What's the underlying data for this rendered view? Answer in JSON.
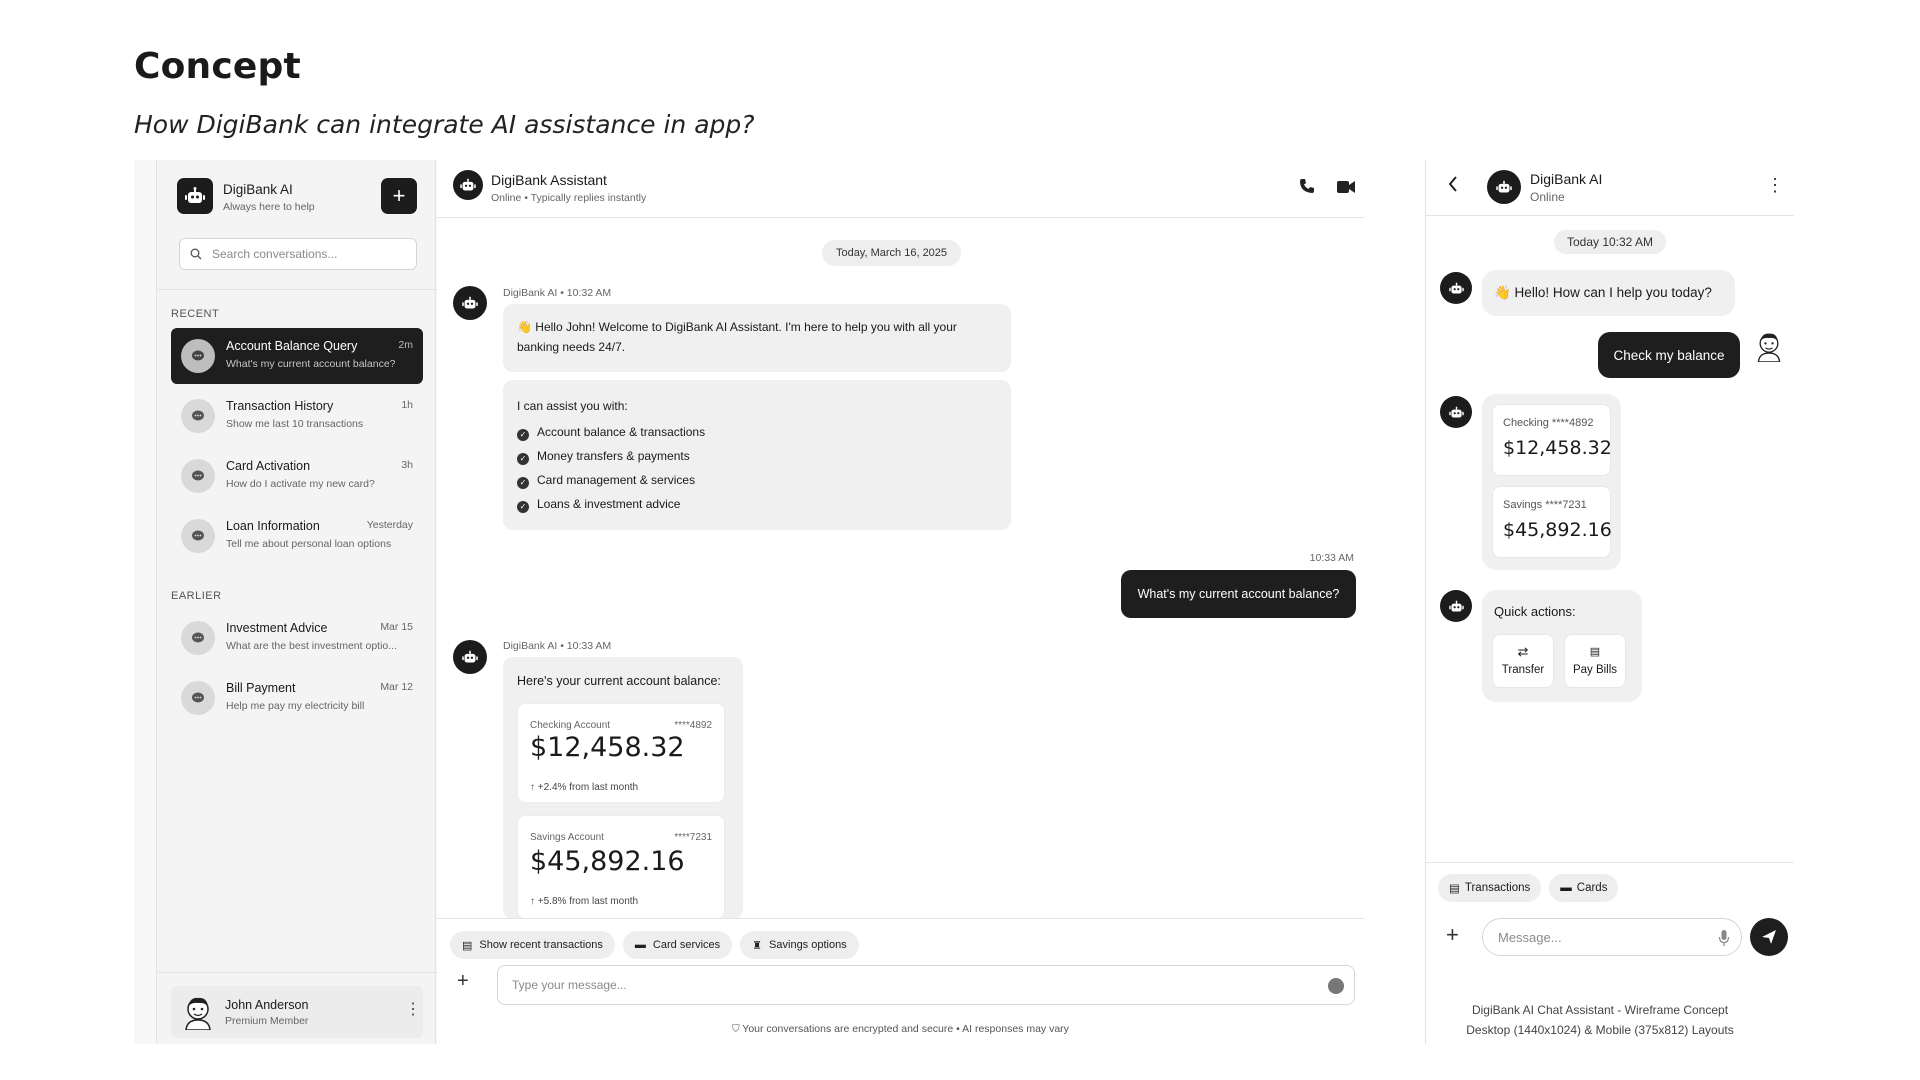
{
  "page": {
    "title": "Concept",
    "subtitle": "How DigiBank can integrate AI assistance in app?",
    "caption_line1": "DigiBank AI Chat Assistant - Wireframe Concept",
    "caption_line2": "Desktop (1440x1024) & Mobile (375x812) Layouts"
  },
  "sidebar": {
    "app_name": "DigiBank AI",
    "app_tagline": "Always here to help",
    "new_chat_label": "+",
    "search_placeholder": "Search conversations...",
    "recent_label": "RECENT",
    "earlier_label": "EARLIER",
    "recent": [
      {
        "title": "Account Balance Query",
        "time": "2m",
        "preview": "What's my current account balance?",
        "active": true
      },
      {
        "title": "Transaction History",
        "time": "1h",
        "preview": "Show me last 10 transactions"
      },
      {
        "title": "Card Activation",
        "time": "3h",
        "preview": "How do I activate my new card?"
      },
      {
        "title": "Loan Information",
        "time": "Yesterday",
        "preview": "Tell me about personal loan options"
      }
    ],
    "earlier": [
      {
        "title": "Investment Advice",
        "time": "Mar 15",
        "preview": "What are the best investment optio..."
      },
      {
        "title": "Bill Payment",
        "time": "Mar 12",
        "preview": "Help me pay my electricity bill"
      }
    ],
    "user": {
      "name": "John Anderson",
      "tier": "Premium Member"
    }
  },
  "chat": {
    "title": "DigiBank Assistant",
    "status": "Online • Typically replies instantly",
    "date_divider": "Today, March 16, 2025",
    "msg1_meta": "DigiBank AI • 10:32 AM",
    "msg1_text_line1": "👋 Hello John! Welcome to DigiBank AI Assistant. I'm here to help you with all your",
    "msg1_text_line2": "banking needs 24/7.",
    "assist_intro": "I can assist you with:",
    "assist_items": [
      "Account balance & transactions",
      "Money transfers & payments",
      "Card management & services",
      "Loans & investment advice"
    ],
    "user_time": "10:33 AM",
    "user_msg": "What's my current account balance?",
    "msg2_meta": "DigiBank AI • 10:33 AM",
    "msg2_intro": "Here's your current account balance:",
    "accounts": [
      {
        "label": "Checking Account",
        "number": "****4892",
        "balance": "$12,458.32",
        "change": "↑ +2.4% from last month"
      },
      {
        "label": "Savings Account",
        "number": "****7231",
        "balance": "$45,892.16",
        "change": "↑ +5.8% from last month"
      }
    ],
    "quick_replies": [
      "Show recent transactions",
      "Card services",
      "Savings options"
    ],
    "input_placeholder": "Type your message...",
    "security_note": "Your conversations are encrypted and secure • AI responses may vary"
  },
  "mobile": {
    "title": "DigiBank AI",
    "status": "Online",
    "date_divider": "Today 10:32 AM",
    "greeting": "👋 Hello! How can I help you today?",
    "user_msg": "Check my balance",
    "accounts": [
      {
        "label": "Checking ****4892",
        "balance": "$12,458.32"
      },
      {
        "label": "Savings ****7231",
        "balance": "$45,892.16"
      }
    ],
    "quick_actions_label": "Quick actions:",
    "quick_actions": [
      "Transfer",
      "Pay Bills"
    ],
    "chips": [
      "Transactions",
      "Cards"
    ],
    "input_placeholder": "Message..."
  }
}
